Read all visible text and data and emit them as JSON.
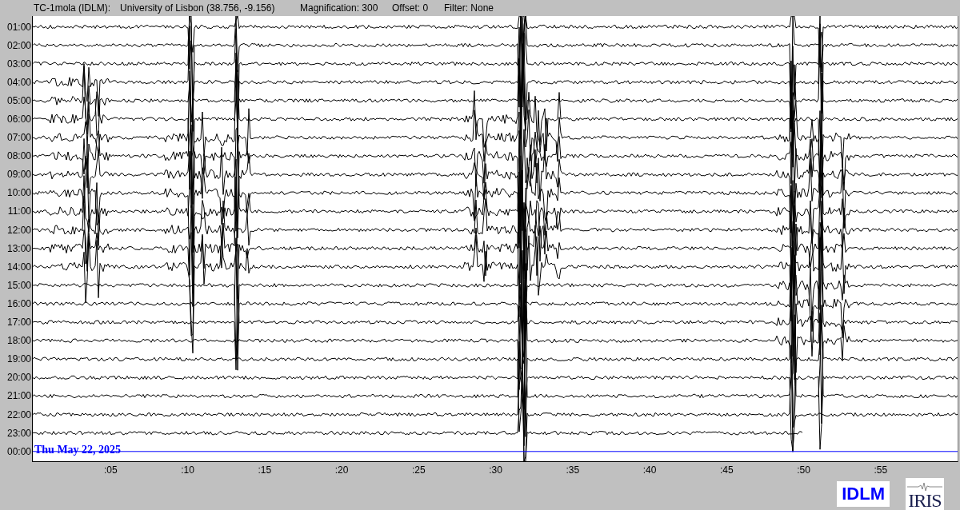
{
  "header": {
    "station": "TC-1mola (IDLM):",
    "location": "University of Lisbon (38.756, -9.156)",
    "magnification": "Magnification: 300",
    "offset": "Offset: 0",
    "filter": "Filter: None"
  },
  "rows": [
    {
      "label": "01:00"
    },
    {
      "label": "02:00"
    },
    {
      "label": "03:00"
    },
    {
      "label": "04:00"
    },
    {
      "label": "05:00"
    },
    {
      "label": "06:00"
    },
    {
      "label": "07:00"
    },
    {
      "label": "08:00"
    },
    {
      "label": "09:00"
    },
    {
      "label": "10:00"
    },
    {
      "label": "11:00"
    },
    {
      "label": "12:00"
    },
    {
      "label": "13:00"
    },
    {
      "label": "14:00"
    },
    {
      "label": "15:00"
    },
    {
      "label": "16:00"
    },
    {
      "label": "17:00"
    },
    {
      "label": "18:00"
    },
    {
      "label": "19:00"
    },
    {
      "label": "20:00"
    },
    {
      "label": "21:00"
    },
    {
      "label": "22:00"
    },
    {
      "label": "23:00"
    },
    {
      "label": "00:00"
    }
  ],
  "date_label": "Thu May 22, 2025",
  "x_ticks": [
    ":05",
    ":10",
    ":15",
    ":20",
    ":25",
    ":30",
    ":35",
    ":40",
    ":45",
    ":50",
    ":55"
  ],
  "logos": [
    {
      "kind": "network",
      "text": "IDLM"
    },
    {
      "kind": "institution",
      "text": "IRIS"
    }
  ]
}
